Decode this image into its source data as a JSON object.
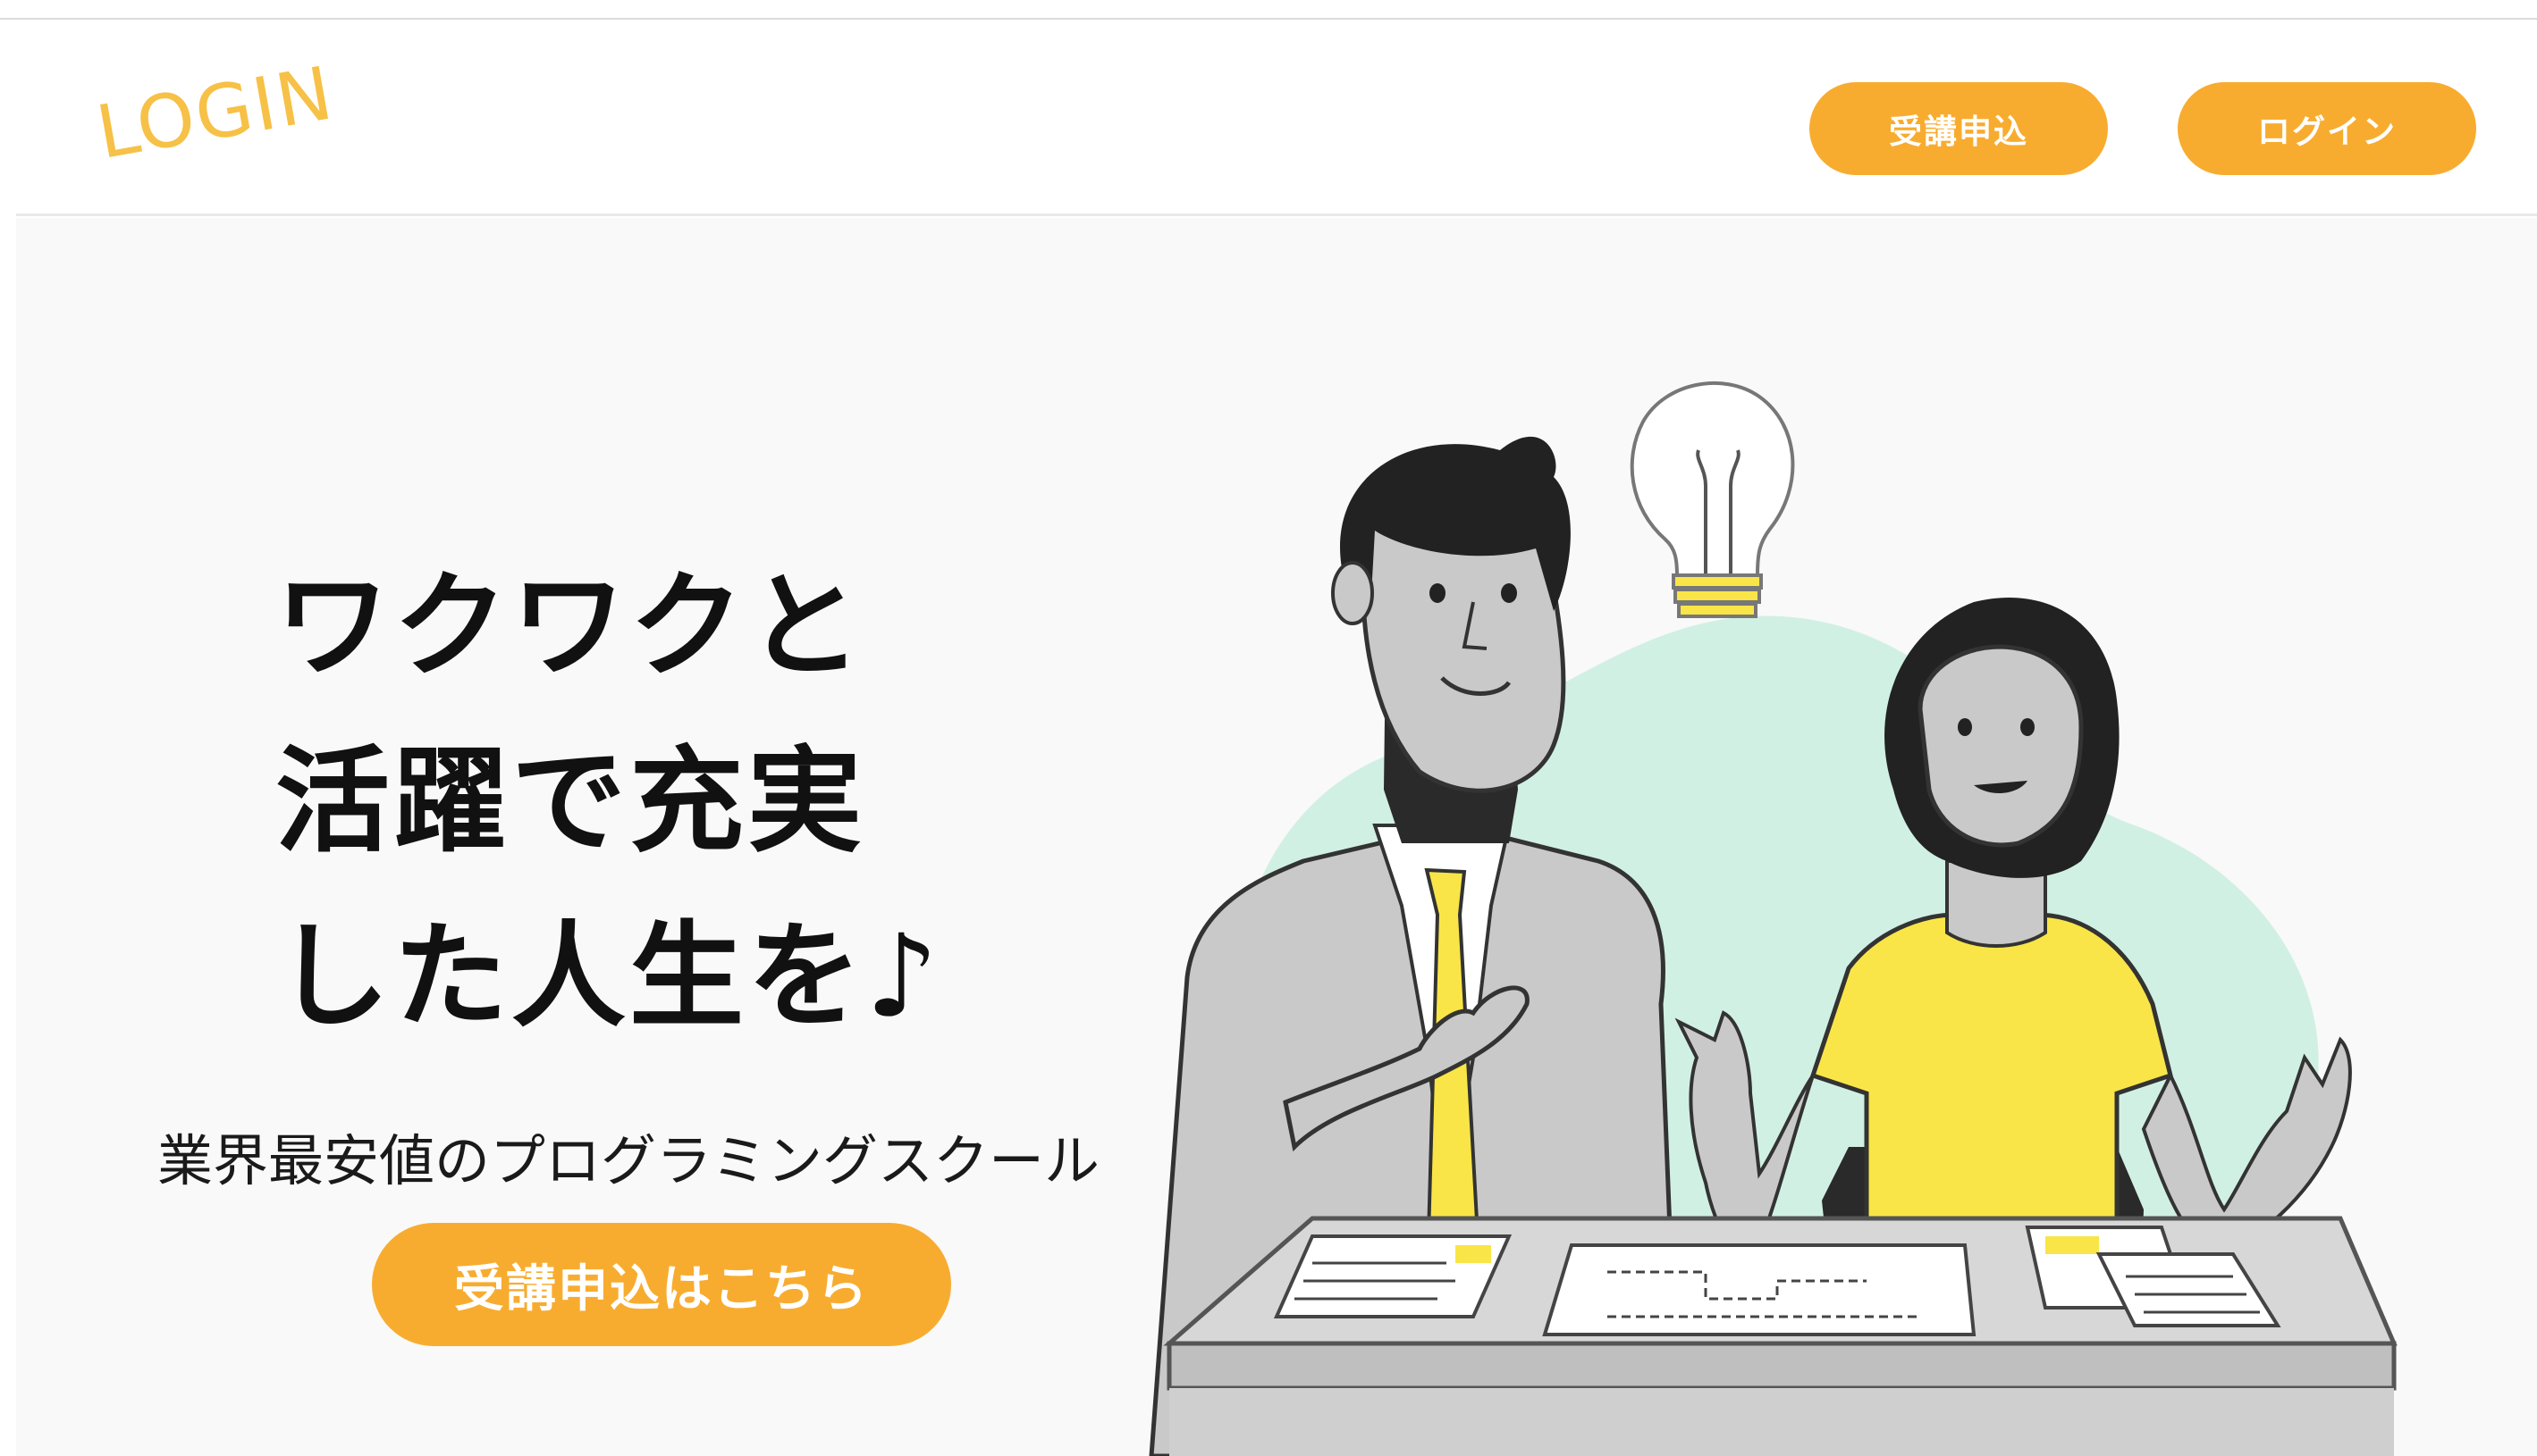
{
  "header": {
    "logo": "LOGIN",
    "nav": {
      "apply_label": "受講申込",
      "login_label": "ログイン"
    }
  },
  "hero": {
    "headline_lines": [
      "ワクワクと",
      "活躍で充実",
      "した人生を♪"
    ],
    "subheading": "業界最安値のプログラミングスクール",
    "cta_label": "受講申込はこちら"
  },
  "colors": {
    "accent": "#f8ac2f",
    "logo": "#f6c146",
    "illustration_yellow": "#f9e547",
    "blob_mint": "#d1f0e4"
  },
  "illustration": {
    "subject": "man-and-woman-discussing-idea",
    "icons": [
      "lightbulb-icon"
    ]
  }
}
